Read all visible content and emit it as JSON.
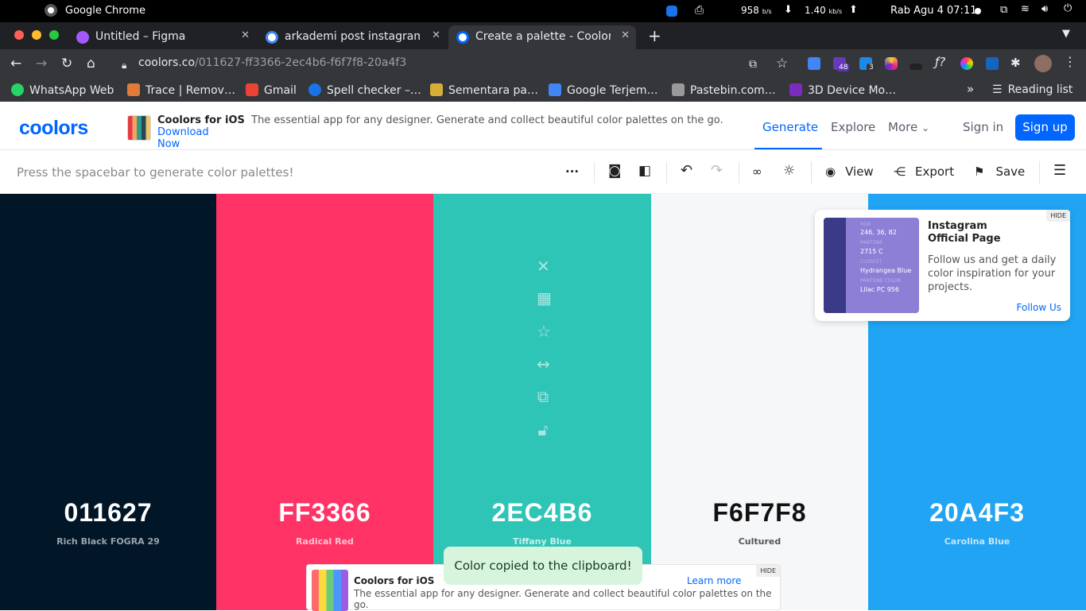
{
  "os": {
    "app_name": "Google Chrome",
    "net_down": "958",
    "net_down_unit": "b/s",
    "net_up": "1.40",
    "net_up_unit": "kb/s",
    "clock": "Rab Agu 4  07:11"
  },
  "tabs": [
    {
      "title": "Untitled – Figma",
      "fav_color": "#a259ff"
    },
    {
      "title": "arkademi post instagram",
      "fav_color": "#4285f4"
    },
    {
      "title": "Create a palette - Coolors",
      "fav_color": "#0066ff",
      "active": true
    }
  ],
  "address": {
    "host": "coolors.co",
    "path": "/011627-ff3366-2ec4b6-f6f7f8-20a4f3"
  },
  "extensions": {
    "badge_48": "48",
    "badge_3": "3"
  },
  "bookmarks": [
    {
      "label": "WhatsApp Web",
      "color": "#25d366"
    },
    {
      "label": "Trace | Remov…",
      "color": "#e07b39"
    },
    {
      "label": "Gmail",
      "color": "#ea4335"
    },
    {
      "label": "Spell checker –…",
      "color": "#1a73e8"
    },
    {
      "label": "Sementara pa…",
      "color": "#d4af37"
    },
    {
      "label": "Google Terjem…",
      "color": "#4285f4"
    },
    {
      "label": "Pastebin.com…",
      "color": "#999999"
    },
    {
      "label": "3D Device Mo…",
      "color": "#7b2cbf"
    }
  ],
  "bookmarks_overflow": "»",
  "reading_list": "Reading list",
  "header": {
    "logo": "coolors",
    "promo_title": "Coolors for iOS",
    "promo_text": "The essential app for any designer. Generate and collect beautiful color palettes on the go.",
    "promo_link_1": "Download",
    "promo_link_2": "Now",
    "nav_generate": "Generate",
    "nav_explore": "Explore",
    "nav_more": "More",
    "sign_in": "Sign in",
    "sign_up": "Sign up"
  },
  "toolbar": {
    "hint": "Press the spacebar to generate color palettes!",
    "view": "View",
    "export": "Export",
    "save": "Save"
  },
  "palette": [
    {
      "hex": "011627",
      "name": "Rich Black FOGRA 29",
      "bg": "#011627",
      "fg": "#ffffff",
      "name_color": "#9aa3ad"
    },
    {
      "hex": "FF3366",
      "name": "Radical Red",
      "bg": "#ff3366",
      "fg": "#ffffff",
      "name_color": "#ffc2d1"
    },
    {
      "hex": "2EC4B6",
      "name": "Tiffany Blue",
      "bg": "#2ec4b6",
      "fg": "#ffffff",
      "name_color": "#c7f1ed"
    },
    {
      "hex": "F6F7F8",
      "name": "Cultured",
      "bg": "#f6f7f8",
      "fg": "#111111",
      "name_color": "#555555"
    },
    {
      "hex": "20A4F3",
      "name": "Carolina Blue",
      "bg": "#20a4f3",
      "fg": "#ffffff",
      "name_color": "#c4e6fc"
    }
  ],
  "ig_card": {
    "hide": "HIDE",
    "title": "Instagram Official Page",
    "text": "Follow us and get a daily color inspiration for your projects.",
    "follow": "Follow Us",
    "img_rgb_label": "RGB",
    "img_rgb": "246, 36, 82",
    "img_pantone_label": "PANTONE",
    "img_pantone": "2715 C",
    "img_closest_label": "CLOSEST",
    "img_closest": "Hydrangea Blue",
    "img_ral_label": "PANTONE COLOR",
    "img_ral": "Lilac PC 956"
  },
  "bottom_card": {
    "hide": "HIDE",
    "title": "Coolors for iOS",
    "text": "The essential app for any designer. Generate and collect beautiful color palettes on the go.",
    "learn": "Learn more"
  },
  "toast": "Color copied to the clipboard!"
}
